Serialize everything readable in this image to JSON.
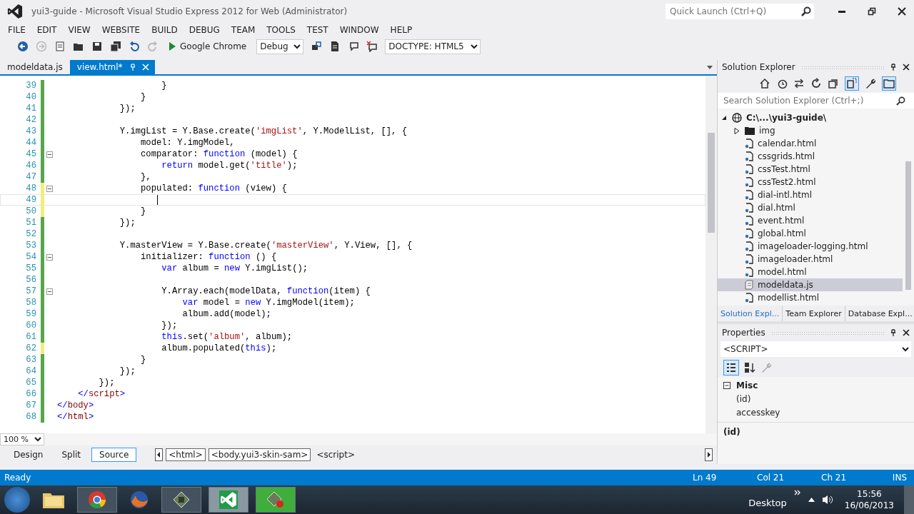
{
  "window": {
    "title": "yui3-guide - Microsoft Visual Studio Express 2012 for Web (Administrator)",
    "quick_launch": {
      "placeholder": "Quick Launch (Ctrl+Q)"
    }
  },
  "menu": [
    "FILE",
    "EDIT",
    "VIEW",
    "WEBSITE",
    "BUILD",
    "DEBUG",
    "TEAM",
    "TOOLS",
    "TEST",
    "WINDOW",
    "HELP"
  ],
  "toolbar": {
    "browser": "Google Chrome",
    "configuration": "Debug",
    "doctype": "DOCTYPE: HTML5"
  },
  "doc_tabs": [
    {
      "label": "modeldata.js",
      "selected": false
    },
    {
      "label": "view.html*",
      "selected": true
    }
  ],
  "code_lines": [
    {
      "n": "39",
      "unsaved": false,
      "fold": false,
      "current": false,
      "segs": [
        {
          "kind": "plain",
          "t": "                    }"
        }
      ]
    },
    {
      "n": "40",
      "unsaved": false,
      "fold": false,
      "current": false,
      "segs": [
        {
          "kind": "plain",
          "t": "                }"
        }
      ]
    },
    {
      "n": "41",
      "unsaved": false,
      "fold": false,
      "current": false,
      "segs": [
        {
          "kind": "plain",
          "t": "            });"
        }
      ]
    },
    {
      "n": "42",
      "unsaved": false,
      "fold": false,
      "current": false
    },
    {
      "n": "43",
      "unsaved": false,
      "fold": false,
      "current": false,
      "segs": [
        {
          "kind": "plain",
          "t": "            Y.imgList = Y.Base.create("
        },
        {
          "kind": "string",
          "t": "'imgList'"
        },
        {
          "kind": "plain",
          "t": ", Y.ModelList, [], {"
        }
      ]
    },
    {
      "n": "44",
      "unsaved": false,
      "fold": false,
      "current": false,
      "segs": [
        {
          "kind": "plain",
          "t": "                model: Y.imgModel,"
        }
      ]
    },
    {
      "n": "45",
      "unsaved": false,
      "fold": true,
      "current": false,
      "segs": [
        {
          "kind": "plain",
          "t": "                comparator: "
        },
        {
          "kind": "keyword",
          "t": "function"
        },
        {
          "kind": "plain",
          "t": " (model) {"
        }
      ]
    },
    {
      "n": "46",
      "unsaved": false,
      "fold": false,
      "current": false,
      "segs": [
        {
          "kind": "keyword",
          "t": "                    return"
        },
        {
          "kind": "plain",
          "t": " model.get("
        },
        {
          "kind": "string",
          "t": "'title'"
        },
        {
          "kind": "plain",
          "t": ");"
        }
      ]
    },
    {
      "n": "47",
      "unsaved": false,
      "fold": false,
      "current": false,
      "segs": [
        {
          "kind": "plain",
          "t": "                },"
        }
      ]
    },
    {
      "n": "48",
      "unsaved": true,
      "fold": true,
      "current": false,
      "segs": [
        {
          "kind": "plain",
          "t": "                populated: "
        },
        {
          "kind": "keyword",
          "t": "function"
        },
        {
          "kind": "plain",
          "t": " (view) {"
        }
      ]
    },
    {
      "n": "49",
      "unsaved": true,
      "fold": false,
      "current": true
    },
    {
      "n": "50",
      "unsaved": true,
      "fold": false,
      "current": false,
      "segs": [
        {
          "kind": "plain",
          "t": "                }"
        }
      ]
    },
    {
      "n": "51",
      "unsaved": false,
      "fold": false,
      "current": false,
      "segs": [
        {
          "kind": "plain",
          "t": "            });"
        }
      ]
    },
    {
      "n": "52",
      "unsaved": false,
      "fold": false,
      "current": false
    },
    {
      "n": "53",
      "unsaved": false,
      "fold": false,
      "current": false,
      "segs": [
        {
          "kind": "plain",
          "t": "            Y.masterView = Y.Base.create("
        },
        {
          "kind": "string",
          "t": "'masterView'"
        },
        {
          "kind": "plain",
          "t": ", Y.View, [], {"
        }
      ]
    },
    {
      "n": "54",
      "unsaved": false,
      "fold": true,
      "current": false,
      "segs": [
        {
          "kind": "plain",
          "t": "                initializer: "
        },
        {
          "kind": "keyword",
          "t": "function"
        },
        {
          "kind": "plain",
          "t": " () {"
        }
      ]
    },
    {
      "n": "55",
      "unsaved": false,
      "fold": false,
      "current": false,
      "segs": [
        {
          "kind": "keyword",
          "t": "                    var"
        },
        {
          "kind": "plain",
          "t": " album = "
        },
        {
          "kind": "keyword",
          "t": "new"
        },
        {
          "kind": "plain",
          "t": " Y.imgList();"
        }
      ]
    },
    {
      "n": "56",
      "unsaved": false,
      "fold": false,
      "current": false
    },
    {
      "n": "57",
      "unsaved": false,
      "fold": true,
      "current": false,
      "segs": [
        {
          "kind": "plain",
          "t": "                    Y.Array.each(modelData, "
        },
        {
          "kind": "keyword",
          "t": "function"
        },
        {
          "kind": "plain",
          "t": "(item) {"
        }
      ]
    },
    {
      "n": "58",
      "unsaved": false,
      "fold": false,
      "current": false,
      "segs": [
        {
          "kind": "keyword",
          "t": "                        var"
        },
        {
          "kind": "plain",
          "t": " model = "
        },
        {
          "kind": "keyword",
          "t": "new"
        },
        {
          "kind": "plain",
          "t": " Y.imgModel(item);"
        }
      ]
    },
    {
      "n": "59",
      "unsaved": false,
      "fold": false,
      "current": false,
      "segs": [
        {
          "kind": "plain",
          "t": "                        album.add(model);"
        }
      ]
    },
    {
      "n": "60",
      "unsaved": false,
      "fold": false,
      "current": false,
      "segs": [
        {
          "kind": "plain",
          "t": "                    });"
        }
      ]
    },
    {
      "n": "61",
      "unsaved": false,
      "fold": false,
      "current": false,
      "segs": [
        {
          "kind": "keyword",
          "t": "                    this"
        },
        {
          "kind": "plain",
          "t": ".set("
        },
        {
          "kind": "string",
          "t": "'album'"
        },
        {
          "kind": "plain",
          "t": ", album);"
        }
      ]
    },
    {
      "n": "62",
      "unsaved": true,
      "fold": false,
      "current": false,
      "segs": [
        {
          "kind": "plain",
          "t": "                    album.populated("
        },
        {
          "kind": "keyword",
          "t": "this"
        },
        {
          "kind": "plain",
          "t": ");"
        }
      ]
    },
    {
      "n": "63",
      "unsaved": false,
      "fold": false,
      "current": false,
      "segs": [
        {
          "kind": "plain",
          "t": "                }"
        }
      ]
    },
    {
      "n": "64",
      "unsaved": false,
      "fold": false,
      "current": false,
      "segs": [
        {
          "kind": "plain",
          "t": "            });"
        }
      ]
    },
    {
      "n": "65",
      "unsaved": false,
      "fold": false,
      "current": false,
      "segs": [
        {
          "kind": "plain",
          "t": "        });"
        }
      ]
    },
    {
      "n": "66",
      "unsaved": false,
      "fold": false,
      "current": false,
      "segs": [
        {
          "kind": "bracket",
          "t": "    </"
        },
        {
          "kind": "tag",
          "t": "script"
        },
        {
          "kind": "bracket",
          "t": ">"
        }
      ]
    },
    {
      "n": "67",
      "unsaved": false,
      "fold": false,
      "current": false,
      "segs": [
        {
          "kind": "bracket",
          "t": "</"
        },
        {
          "kind": "tag",
          "t": "body"
        },
        {
          "kind": "bracket",
          "t": ">"
        }
      ]
    },
    {
      "n": "68",
      "unsaved": false,
      "fold": false,
      "current": false,
      "segs": [
        {
          "kind": "bracket",
          "t": "</"
        },
        {
          "kind": "tag",
          "t": "html"
        },
        {
          "kind": "bracket",
          "t": ">"
        }
      ]
    }
  ],
  "zoom": "100 %",
  "view_tabs": [
    {
      "label": "Design",
      "selected": false
    },
    {
      "label": "Split",
      "selected": false
    },
    {
      "label": "Source",
      "selected": true
    }
  ],
  "breadcrumb": [
    {
      "label": "<html>",
      "kind": "boxed"
    },
    {
      "label": "<body.yui3-skin-sam>",
      "kind": "boxed"
    },
    {
      "label": "<script>",
      "kind": "plain"
    }
  ],
  "solution_explorer": {
    "title": "Solution Explorer",
    "search": {
      "placeholder": "Search Solution Explorer (Ctrl+;)"
    },
    "tree": [
      {
        "label": "C:\\...\\yui3-guide\\",
        "kind": "site",
        "expanded": true,
        "selected": false,
        "children": [
          {
            "label": "img",
            "kind": "folder",
            "expanded": false,
            "selected": false
          },
          {
            "label": "calendar.html",
            "kind": "html",
            "selected": false
          },
          {
            "label": "cssgrids.html",
            "kind": "html",
            "selected": false
          },
          {
            "label": "cssTest.html",
            "kind": "html",
            "selected": false
          },
          {
            "label": "cssTest2.html",
            "kind": "html",
            "selected": false
          },
          {
            "label": "dial-intl.html",
            "kind": "html",
            "selected": false
          },
          {
            "label": "dial.html",
            "kind": "html",
            "selected": false
          },
          {
            "label": "event.html",
            "kind": "html",
            "selected": false
          },
          {
            "label": "global.html",
            "kind": "html",
            "selected": false
          },
          {
            "label": "imageloader-logging.html",
            "kind": "html",
            "selected": false
          },
          {
            "label": "imageloader.html",
            "kind": "html",
            "selected": false
          },
          {
            "label": "model.html",
            "kind": "html",
            "selected": false
          },
          {
            "label": "modeldata.js",
            "kind": "js",
            "selected": true
          },
          {
            "label": "modellist.html",
            "kind": "html",
            "selected": false
          }
        ]
      }
    ],
    "tabs": [
      {
        "label": "Solution Expl...",
        "selected": true
      },
      {
        "label": "Team Explorer",
        "selected": false
      },
      {
        "label": "Database Expl...",
        "selected": false
      }
    ]
  },
  "properties": {
    "title": "Properties",
    "object": "<SCRIPT>",
    "category": "Misc",
    "rows": [
      "(id)",
      "accesskey"
    ],
    "description": "(id)"
  },
  "status_bar": {
    "message": "Ready",
    "line": "Ln 49",
    "col": "Col 21",
    "ch": "Ch 21",
    "mode": "INS"
  },
  "taskbar": {
    "desktop": "Desktop",
    "time": "15:56",
    "date": "16/06/2013"
  }
}
